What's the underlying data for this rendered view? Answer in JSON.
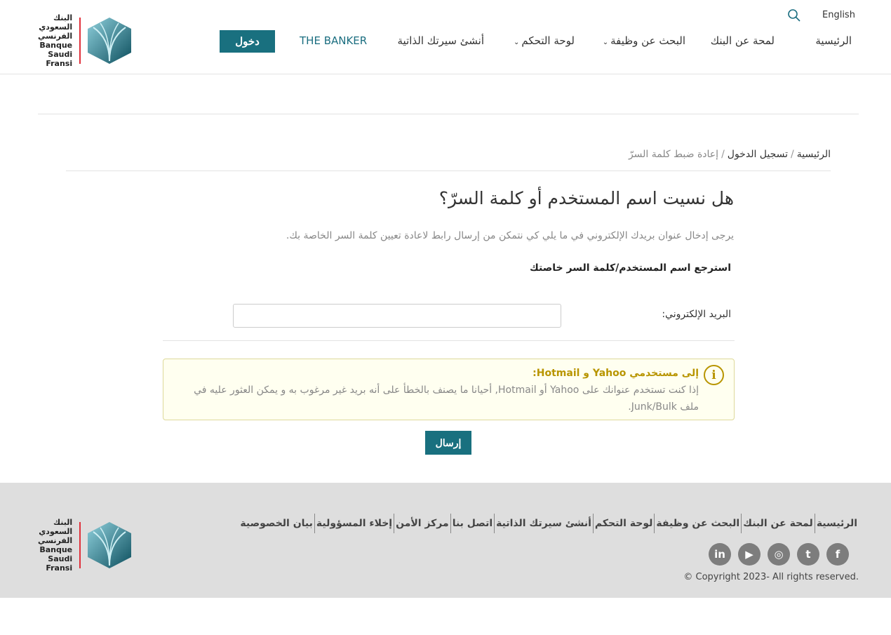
{
  "header": {
    "logo": {
      "arabic": [
        "البنك",
        "السعودي",
        "الفرنسي"
      ],
      "english": [
        "Banque",
        "Saudi",
        "Fransi"
      ]
    },
    "language_link": "English",
    "search_icon": "search-icon",
    "nav": [
      {
        "label": "الرئيسية"
      },
      {
        "label": "لمحة عن البنك"
      },
      {
        "label": "البحث عن وظيفة",
        "dropdown": true
      },
      {
        "label": "لوحة التحكم",
        "dropdown": true
      },
      {
        "label": "أنشئ سيرتك الذاتية"
      },
      {
        "label": "THE BANKER"
      }
    ],
    "login_label": "دخول"
  },
  "breadcrumb": {
    "items": [
      "الرئيسية",
      "تسجيل الدخول"
    ],
    "current": "إعادة ضبط كلمة السرّ",
    "separator": "/"
  },
  "main": {
    "title": "هل نسيت اسم المستخدم أو كلمة السرّ؟",
    "description": "يرجى إدخال عنوان بريدك الإلكتروني في ما يلي كي نتمكن من إرسال رابط لاعادة تعيين كلمة السر الخاصة بك.",
    "subtitle": "استرجع اسم المستخدم/كلمة السر خاصتك",
    "email_label": "البريد الإلكتروني:",
    "email_value": "",
    "notice": {
      "icon": "info-icon",
      "title": "إلى مستخدمي Yahoo و Hotmail:",
      "body": "إذا كنت تستخدم عنوانك على Yahoo أو Hotmail, أحيانا ما يصنف بالخطأ على أنه بريد غير مرغوب به و يمكن العثور عليه في ملف Junk/Bulk."
    },
    "submit_label": "إرسال"
  },
  "footer": {
    "links": [
      "الرئيسية",
      "لمحة عن البنك",
      "البحث عن وظيفة",
      "لوحة التحكم",
      "أنشئ سيرتك الذاتية",
      "اتصل بنا",
      "مركز الأمن",
      "إخلاء المسؤولية",
      "بيان الخصوصية"
    ],
    "social": [
      {
        "icon": "facebook-icon",
        "glyph": "f"
      },
      {
        "icon": "twitter-icon",
        "glyph": "t"
      },
      {
        "icon": "instagram-icon",
        "glyph": "◎"
      },
      {
        "icon": "youtube-icon",
        "glyph": "▶"
      },
      {
        "icon": "linkedin-icon",
        "glyph": "in"
      }
    ],
    "copyright": "© Copyright 2023- All rights reserved."
  },
  "colors": {
    "primary": "#19707f",
    "notice_accent": "#b89500",
    "footer_bg": "#dedede"
  }
}
